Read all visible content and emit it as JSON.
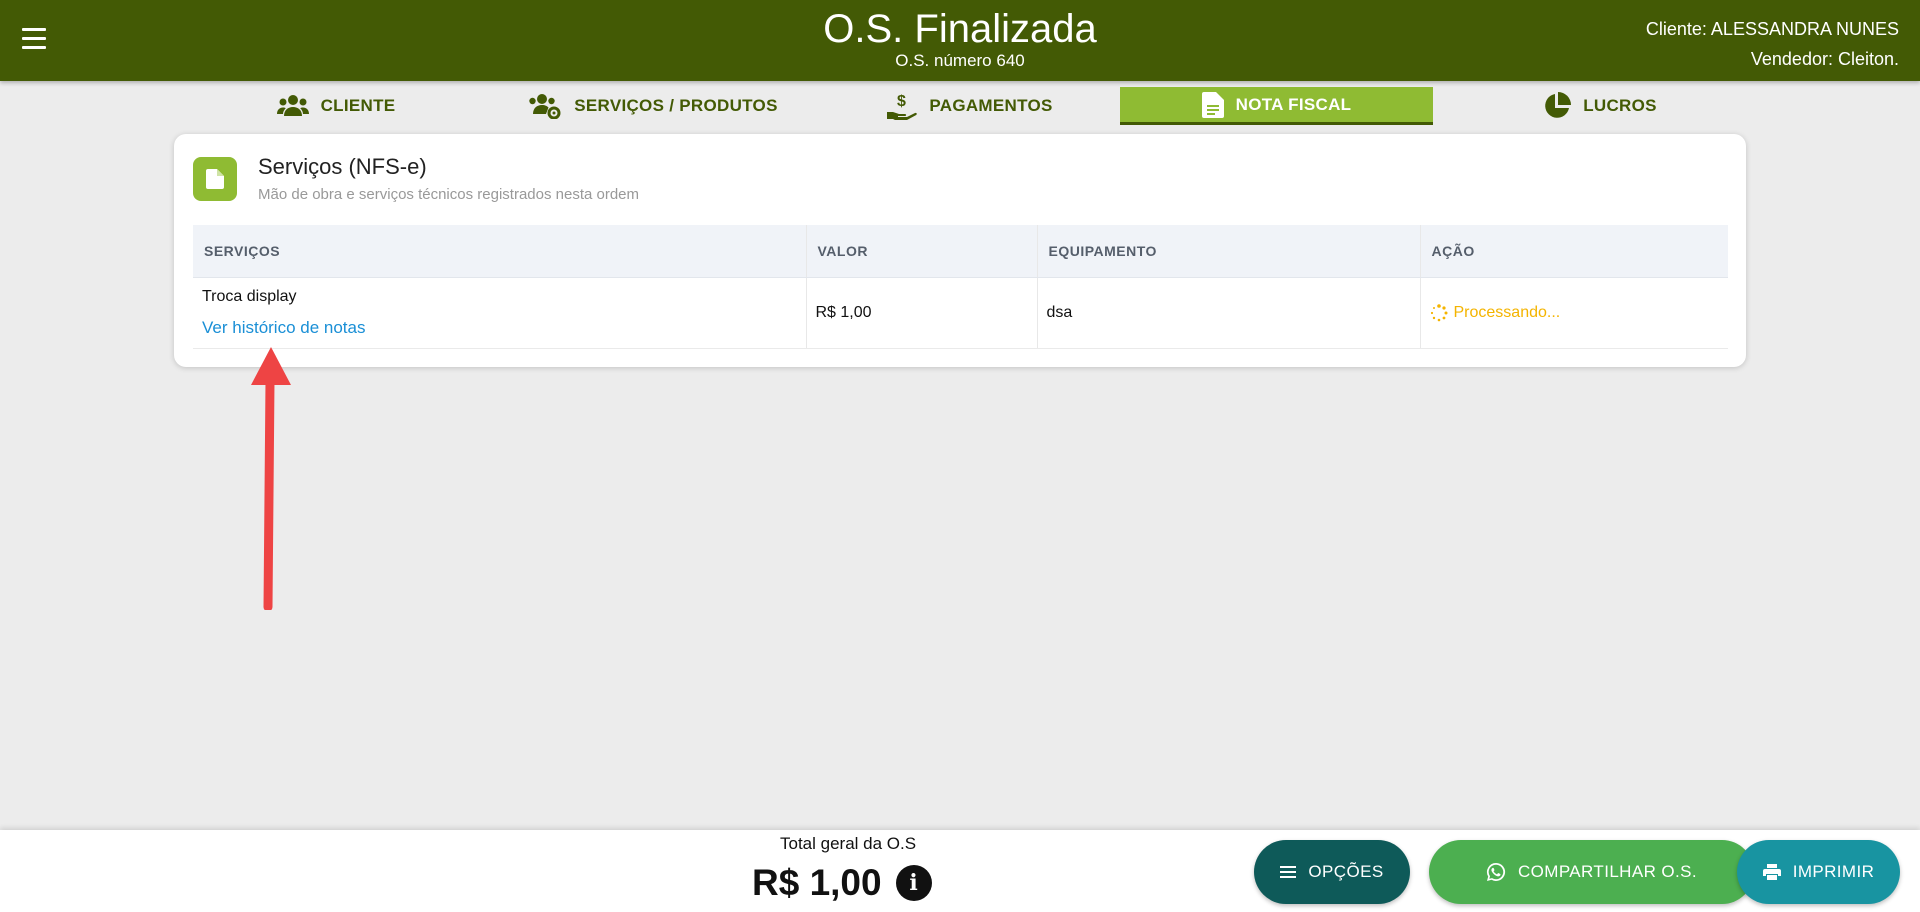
{
  "header": {
    "title": "O.S. Finalizada",
    "subtitle": "O.S. número 640",
    "client": "Cliente: ALESSANDRA NUNES",
    "seller": "Vendedor: Cleiton.",
    "bg_color": "#435a05"
  },
  "tabs": [
    {
      "label": "CLIENTE",
      "icon": "users-icon",
      "active": false
    },
    {
      "label": "SERVIÇOS / PRODUTOS",
      "icon": "users-gear-icon",
      "active": false
    },
    {
      "label": "PAGAMENTOS",
      "icon": "hand-dollar-icon",
      "active": false
    },
    {
      "label": "NOTA FISCAL",
      "icon": "file-invoice-icon",
      "active": true
    },
    {
      "label": "LUCROS",
      "icon": "pie-chart-icon",
      "active": false
    }
  ],
  "card": {
    "title": "Serviços (NFS-e)",
    "subtitle": "Mão de obra e serviços técnicos registrados nesta ordem",
    "icon": "document-icon",
    "accent_color": "#8fbb33"
  },
  "table": {
    "headers": [
      "SERVIÇOS",
      "VALOR",
      "EQUIPAMENTO",
      "AÇÃO"
    ],
    "rows": [
      {
        "service": "Troca display",
        "history_link": "Ver histórico de notas",
        "value": "R$ 1,00",
        "equipment": "dsa",
        "status": "Processando..."
      }
    ]
  },
  "footer": {
    "total_label": "Total geral da O.S",
    "total_value": "R$ 1,00",
    "buttons": {
      "options": "OPÇÕES",
      "share": "COMPARTILHAR O.S.",
      "print": "IMPRIMIR"
    },
    "colors": {
      "options": "#0e5a59",
      "share": "#4caf50",
      "print": "#1894a1"
    }
  },
  "annotation": {
    "icon": "red-arrow-icon",
    "color": "#ee4444"
  }
}
